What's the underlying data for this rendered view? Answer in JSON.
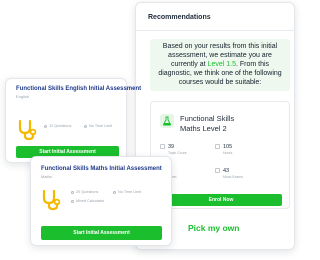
{
  "recommendations": {
    "title": "Recommendations",
    "message_line1": "Based on your results from this initial assessment, we estimate you are currently at ",
    "level": "Level 1.5",
    "message_line2": ". From this diagnostic, we think one of the following courses would be suitable:",
    "course": {
      "icon": "flask-icon",
      "name_line1": "Functional Skills",
      "name_line2": "Maths Level 2",
      "stats": [
        {
          "icon": "document-icon",
          "value": "39",
          "label": "Topic Count"
        },
        {
          "icon": "document-icon",
          "value": "105",
          "label": "Hours"
        },
        {
          "icon": "document-icon",
          "value": "",
          "label": "Level"
        },
        {
          "icon": "document-icon",
          "value": "43",
          "label": "Mock Exams"
        }
      ],
      "enrol_label": "Enrol Now"
    },
    "pick_label": "Pick my own",
    "accent": "#1bbf2e"
  },
  "assessments": [
    {
      "title": "Functional Skills English Initial Assessment",
      "subject": "English",
      "icon": "stethoscope-icon",
      "meta": [
        "12 Questions",
        "No Time Limit"
      ],
      "button": "Start Initial Assessment"
    },
    {
      "title": "Functional Skills Maths Initial Assessment",
      "subject": "Maths",
      "icon": "stethoscope-icon",
      "meta": [
        "20 Questions",
        "No Time Limit",
        "Mixed Calculator"
      ],
      "button": "Start Initial Assessment"
    }
  ]
}
